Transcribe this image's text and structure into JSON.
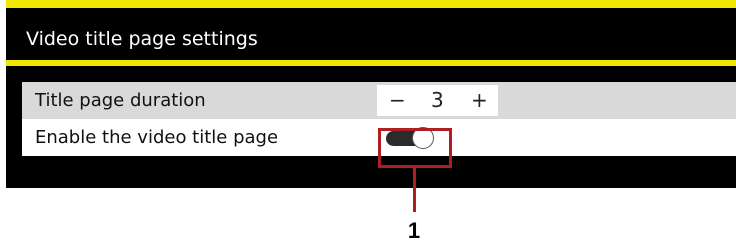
{
  "panel": {
    "title": "Video title page settings",
    "accent_color": "#f2e700",
    "background_color": "#000000"
  },
  "settings": [
    {
      "label": "Title page duration",
      "control": "stepper",
      "decrement_label": "−",
      "value": "3",
      "increment_label": "+"
    },
    {
      "label": "Enable the video title page",
      "control": "toggle",
      "toggle_state": "on"
    }
  ],
  "callout": {
    "number": "1",
    "color": "#b01e24"
  }
}
